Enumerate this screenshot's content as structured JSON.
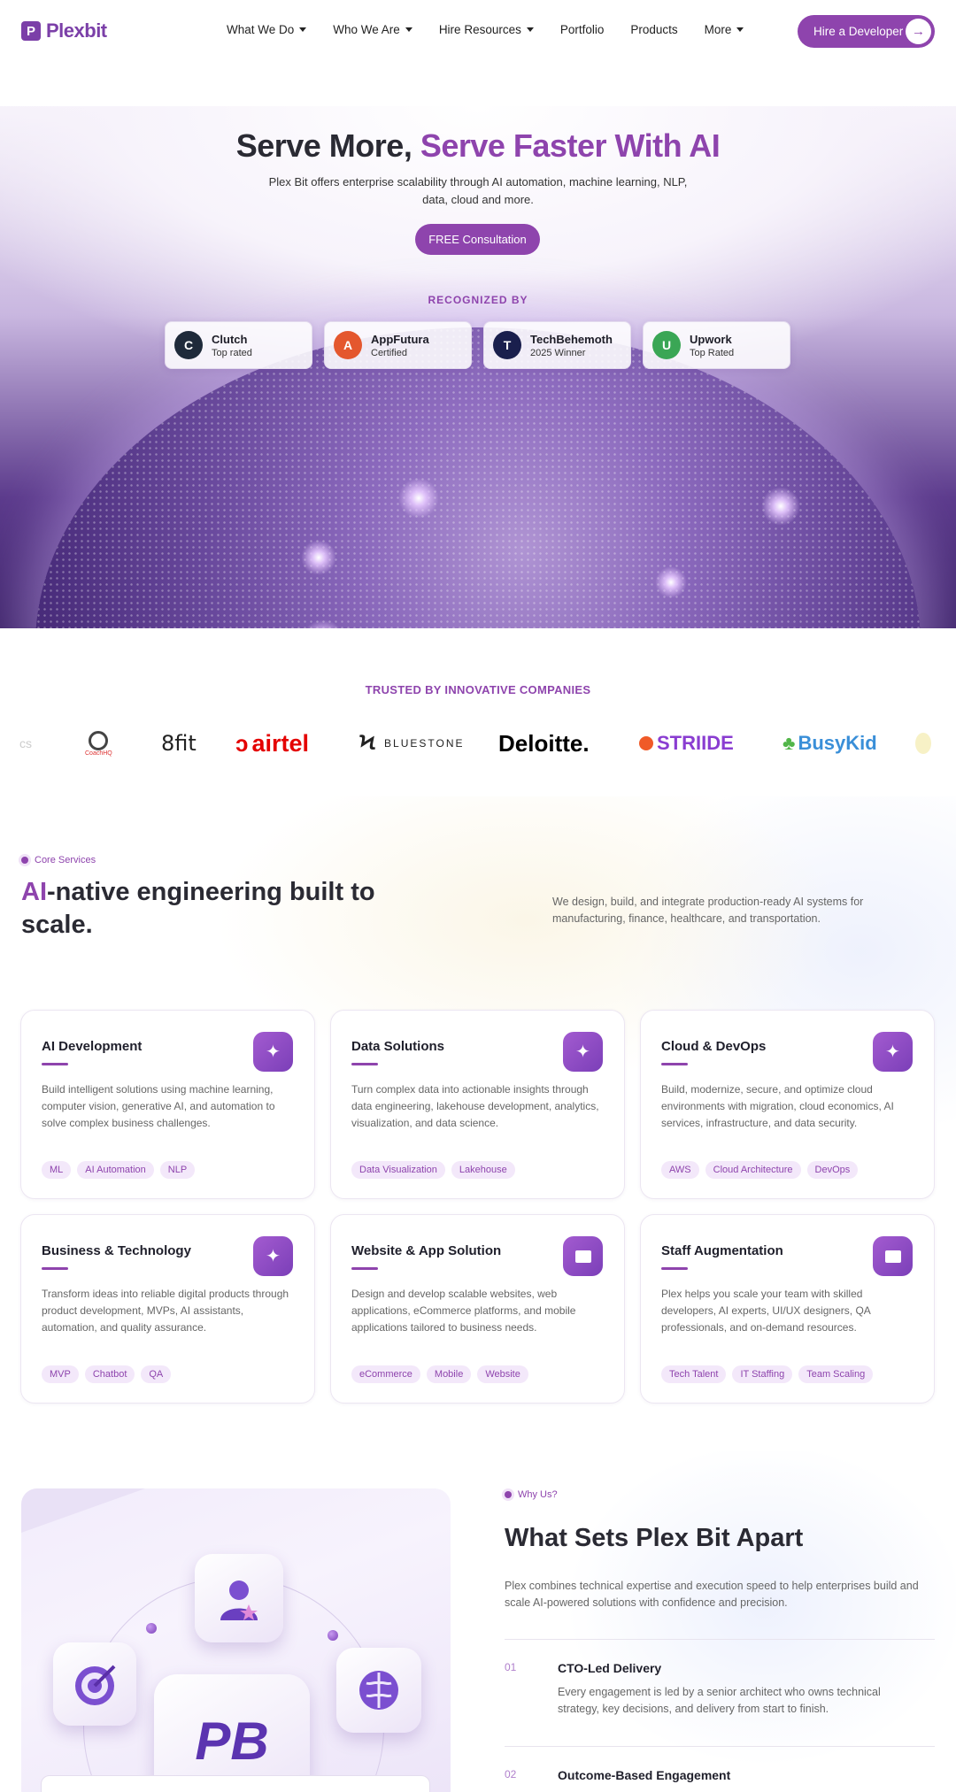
{
  "nav": {
    "logo_text": "Plexbit",
    "items": [
      {
        "label": "What We Do",
        "has_dropdown": true
      },
      {
        "label": "Who We Are",
        "has_dropdown": true
      },
      {
        "label": "Hire Resources",
        "has_dropdown": true
      },
      {
        "label": "Portfolio",
        "has_dropdown": false
      },
      {
        "label": "Products",
        "has_dropdown": false
      },
      {
        "label": "More",
        "has_dropdown": true
      }
    ],
    "cta_label": "Hire a Developer",
    "cta_icon": "arrow-right-icon"
  },
  "hero": {
    "title_plain": "Serve More, ",
    "title_accent": "Serve Faster With AI",
    "subtitle": "Plex Bit offers enterprise scalability through AI automation, machine learning, NLP, data, cloud and more.",
    "cta_label": "FREE Consultation",
    "recognized_label": "RECOGNIZED BY",
    "badges": [
      {
        "name": "Clutch",
        "sub": "Top rated",
        "icon": "clutch-badge-icon",
        "color": "#1f2a3a"
      },
      {
        "name": "AppFutura",
        "sub": "Certified",
        "icon": "appfutura-badge-icon",
        "color": "#e4572e"
      },
      {
        "name": "TechBehemoth",
        "sub": "2025 Winner",
        "icon": "techbehemoth-badge-icon",
        "color": "#1a1f4d"
      },
      {
        "name": "Upwork",
        "sub": "Top Rated",
        "icon": "upwork-badge-icon",
        "color": "#3aa655"
      }
    ]
  },
  "trusted": {
    "label": "TRUSTED BY INNOVATIVE COMPANIES",
    "logos": [
      "CoachHQ",
      "8fit",
      "airtel",
      "BLUESTONE",
      "Deloitte.",
      "STRIIDE",
      "BusyKid"
    ]
  },
  "services": {
    "eyebrow": "Core Services",
    "title_accent": "AI",
    "title_rest": "-native engineering built to scale.",
    "description": "We design, build, and integrate production-ready AI systems for manufacturing, finance, healthcare, and transportation.",
    "cards": [
      {
        "title": "AI Development",
        "text": "Build intelligent solutions using machine learning, computer vision, generative AI, and automation to solve complex business challenges.",
        "tags": [
          "ML",
          "AI Automation",
          "NLP"
        ],
        "icon": "sparkle-icon"
      },
      {
        "title": "Data Solutions",
        "text": "Turn complex data into actionable insights through data engineering, lakehouse development, analytics, visualization, and data science.",
        "tags": [
          "Data Visualization",
          "Lakehouse"
        ],
        "icon": "sparkle-icon"
      },
      {
        "title": "Cloud & DevOps",
        "text": "Build, modernize, secure, and optimize cloud environments with migration, cloud economics, AI services, infrastructure, and data security.",
        "tags": [
          "AWS",
          "Cloud Architecture",
          "DevOps"
        ],
        "icon": "sparkle-icon"
      },
      {
        "title": "Business & Technology",
        "text": "Transform ideas into reliable digital products through product development, MVPs, AI assistants, automation, and quality assurance.",
        "tags": [
          "MVP",
          "Chatbot",
          "QA"
        ],
        "icon": "sparkle-icon"
      },
      {
        "title": "Website & App Solution",
        "text": "Design and develop scalable websites, web applications, eCommerce platforms, and mobile applications tailored to business needs.",
        "tags": [
          "eCommerce",
          "Mobile",
          "Website"
        ],
        "icon": "document-icon"
      },
      {
        "title": "Staff Augmentation",
        "text": "Plex helps you scale your team with skilled developers, AI experts, UI/UX designers, QA professionals, and on-demand resources.",
        "tags": [
          "Tech Talent",
          "IT Staffing",
          "Team Scaling"
        ],
        "icon": "document-icon"
      }
    ]
  },
  "why": {
    "eyebrow": "Why Us?",
    "title": "What Sets Plex Bit Apart",
    "description": "Plex combines technical expertise and execution speed to help enterprises build and scale AI-powered solutions with confidence and precision.",
    "illustration_icons": [
      "person-icon",
      "target-icon",
      "brain-icon",
      "pb-logo-icon"
    ],
    "features": [
      {
        "num": "01",
        "title": "CTO-Led Delivery",
        "text": "Every engagement is led by a senior architect who owns technical strategy, key decisions, and delivery from start to finish."
      },
      {
        "num": "02",
        "title": "Outcome-Based Engagement",
        "text": ""
      }
    ]
  }
}
